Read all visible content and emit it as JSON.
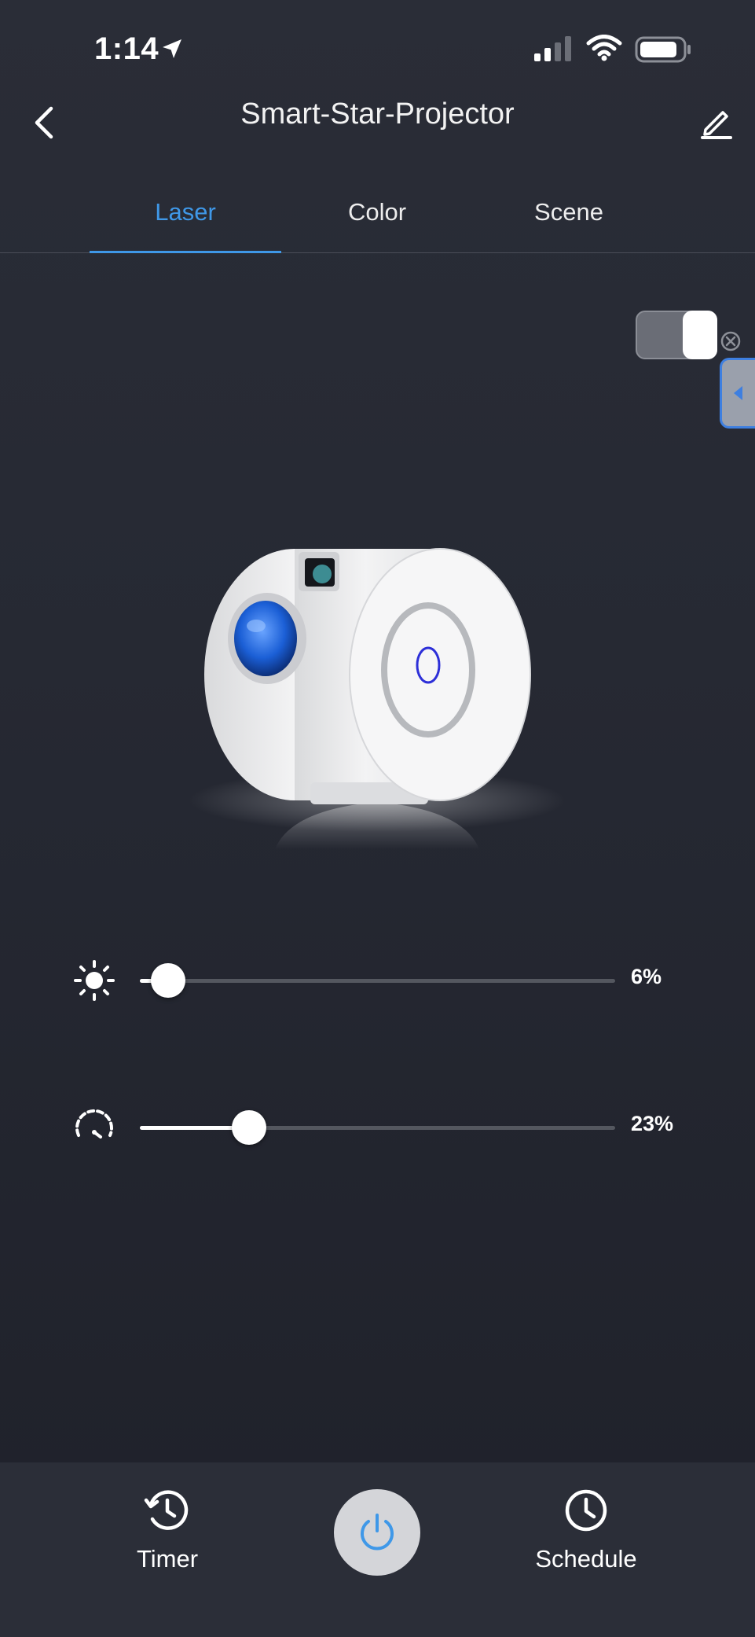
{
  "status": {
    "time": "1:14",
    "icons": [
      "location-arrow-icon",
      "cellular-signal-icon",
      "wifi-icon",
      "battery-icon"
    ]
  },
  "header": {
    "title": "Smart-Star-Projector",
    "back_icon": "chevron-left-icon",
    "edit_icon": "pencil-icon"
  },
  "tabs": [
    {
      "label": "Laser",
      "active": true
    },
    {
      "label": "Color",
      "active": false
    },
    {
      "label": "Scene",
      "active": false
    }
  ],
  "toggle": {
    "on": false
  },
  "sliders": [
    {
      "icon": "brightness-icon",
      "value": 6,
      "value_label": "6%"
    },
    {
      "icon": "speed-icon",
      "value": 23,
      "value_label": "23%"
    }
  ],
  "bottom_bar": {
    "timer_label": "Timer",
    "schedule_label": "Schedule",
    "power_icon": "power-icon"
  },
  "colors": {
    "accent": "#3f98e8",
    "background": "#262933",
    "bottom_bar": "#2b2e38",
    "power_button_bg": "#d4d5d9",
    "lens_blue": "#1b5fd6"
  }
}
